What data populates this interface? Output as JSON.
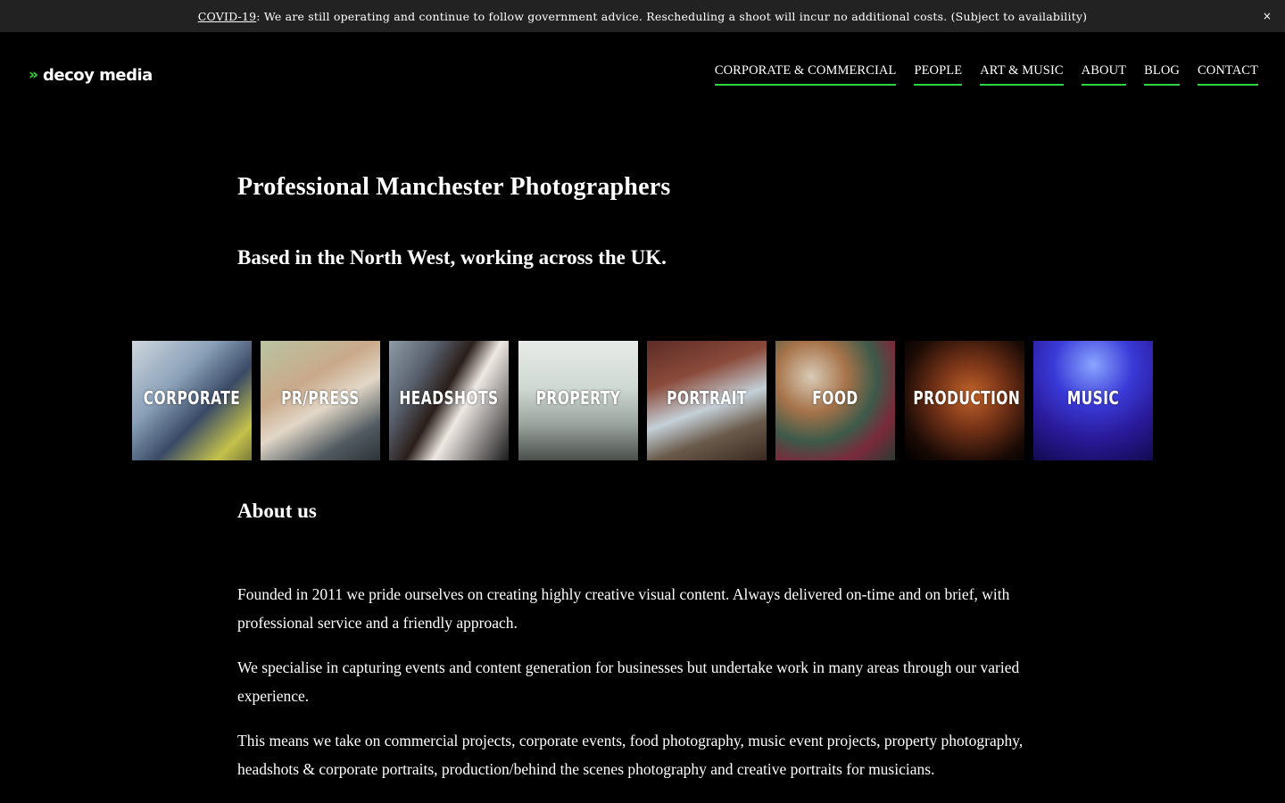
{
  "announcement": {
    "link_text": "COVID-19",
    "text": ": We are still operating and continue to follow government advice. Rescheduling a shoot will incur no additional costs. (Subject to availability)",
    "close_label": "×"
  },
  "header": {
    "logo_chevrons": "»",
    "logo_text": "decoy media",
    "brand_color": "#2bd640",
    "nav": [
      {
        "label": "CORPORATE & COMMERCIAL"
      },
      {
        "label": "PEOPLE"
      },
      {
        "label": "ART & MUSIC"
      },
      {
        "label": "ABOUT"
      },
      {
        "label": "BLOG"
      },
      {
        "label": "CONTACT"
      }
    ]
  },
  "hero": {
    "title": "Professional Manchester Photographers",
    "subtitle": "Based in the North West, working across the UK."
  },
  "categories": [
    {
      "label": "CORPORATE"
    },
    {
      "label": "PR/PRESS"
    },
    {
      "label": "HEADSHOTS"
    },
    {
      "label": "PROPERTY"
    },
    {
      "label": "PORTRAIT"
    },
    {
      "label": "FOOD"
    },
    {
      "label": "PRODUCTION"
    },
    {
      "label": "MUSIC"
    }
  ],
  "about": {
    "heading": "About us",
    "paragraphs": [
      "Founded in 2011 we pride ourselves on creating highly creative visual content. Always delivered on-time and on brief, with professional service and a friendly approach.",
      "We specialise in capturing events and content generation for businesses but undertake work in many areas through our varied experience.",
      "This means we take on commercial projects, corporate events, food photography, music event projects, property photography, headshots & corporate portraits, production/behind the scenes photography and creative portraits for musicians."
    ]
  }
}
